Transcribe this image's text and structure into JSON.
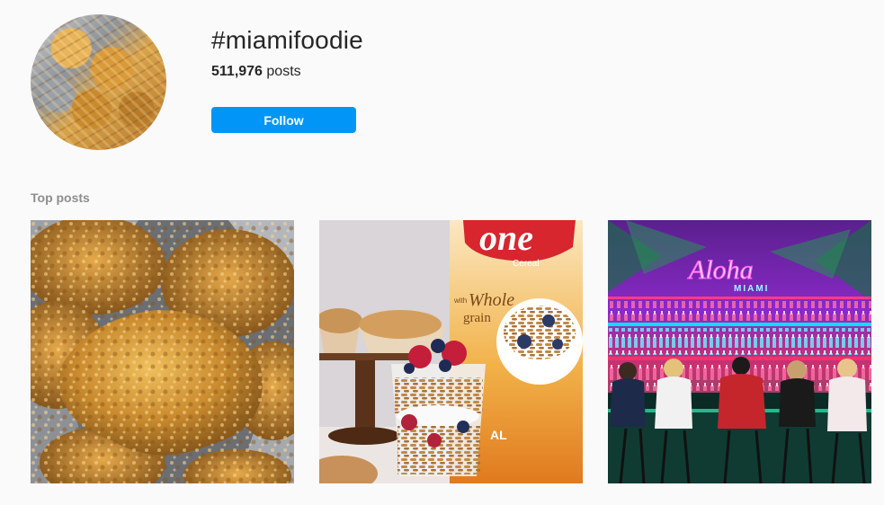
{
  "header": {
    "hashtag": "#miamifoodie",
    "post_count": "511,976",
    "post_count_label": "posts",
    "follow_label": "Follow"
  },
  "top_posts": {
    "heading": "Top posts",
    "posts": [
      {
        "subject": "fried chicken on foil"
      },
      {
        "subject": "One cereal parfait and muffins",
        "box_brand": "one",
        "box_sub": "Cereal",
        "box_with": "with",
        "box_whole": "Whole",
        "box_grain": "grain",
        "box_flavor": "AL"
      },
      {
        "subject": "neon bar interior",
        "sign_main": "Aloha",
        "sign_sub": "MIAMI"
      }
    ]
  },
  "colors": {
    "follow_button": "#0095f6",
    "background": "#fafafa",
    "muted_text": "#8e8e8e"
  }
}
